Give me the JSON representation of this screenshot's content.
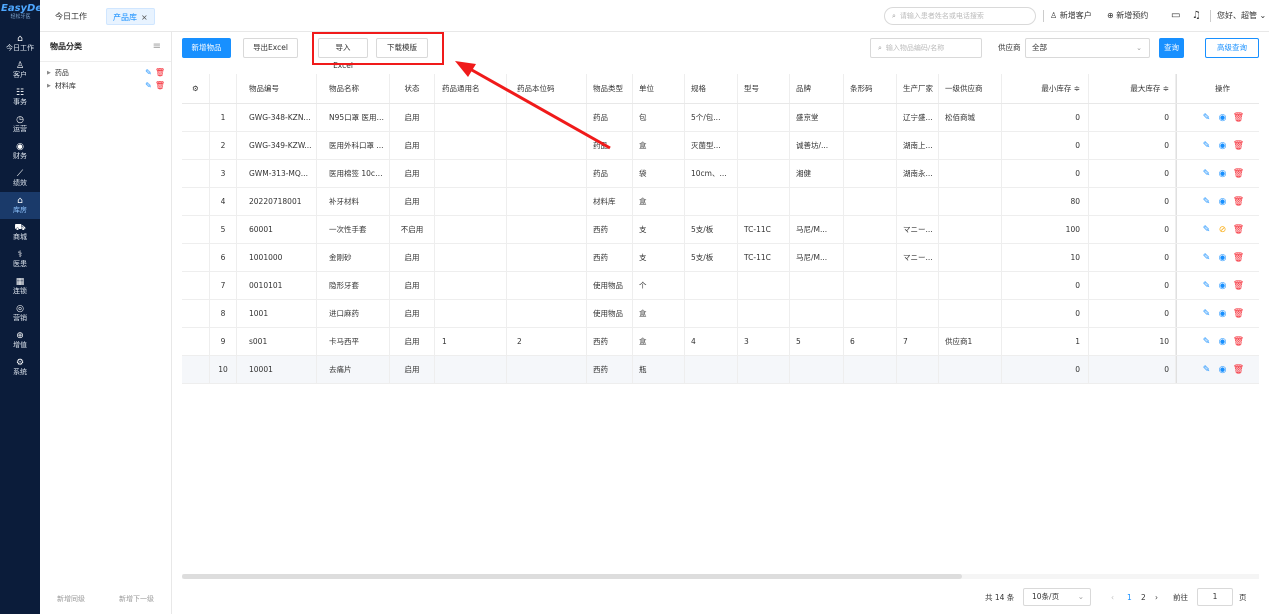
{
  "logo": {
    "line1": "EasyDent",
    "line2": "轻松牙医"
  },
  "nav": [
    {
      "icon": "⌂",
      "label": "今日工作"
    },
    {
      "icon": "♙",
      "label": "客户"
    },
    {
      "icon": "☷",
      "label": "事务"
    },
    {
      "icon": "◷",
      "label": "运营"
    },
    {
      "icon": "◉",
      "label": "财务"
    },
    {
      "icon": "⟋",
      "label": "绩效"
    },
    {
      "icon": "⌂",
      "label": "库房"
    },
    {
      "icon": "⛟",
      "label": "商城"
    },
    {
      "icon": "⚕",
      "label": "医患"
    },
    {
      "icon": "▦",
      "label": "连锁"
    },
    {
      "icon": "◎",
      "label": "营销"
    },
    {
      "icon": "⊕",
      "label": "增值"
    },
    {
      "icon": "⚙",
      "label": "系统"
    }
  ],
  "tabs": {
    "today": "今日工作",
    "product": "产品库",
    "close": "×"
  },
  "topbar": {
    "search_placeholder": "请输入患者姓名或电话搜索",
    "add_customer": "新增客户",
    "add_appointment": "新增预约",
    "greeting": "您好、超管"
  },
  "sidebar": {
    "title": "物品分类",
    "items": [
      {
        "label": "药品"
      },
      {
        "label": "材料库"
      }
    ],
    "add_same": "新增同级",
    "add_child": "新增下一级"
  },
  "toolbar": {
    "add": "新增物品",
    "export": "导出Excel",
    "import": "导入Excel",
    "download": "下载模版",
    "search_placeholder": "输入物品编码/名称",
    "supplier_label": "供应商",
    "supplier_value": "全部",
    "query": "查询",
    "advanced": "高级查询"
  },
  "table": {
    "headers": [
      "",
      "物品编号",
      "物品名称",
      "状态",
      "药品通用名",
      "药品本位码",
      "物品类型",
      "单位",
      "规格",
      "型号",
      "品牌",
      "条形码",
      "生产厂家",
      "一级供应商",
      "最小库存 ≑",
      "最大库存 ≑",
      "操作"
    ],
    "rows": [
      [
        "1",
        "GWG-348-KZN...",
        "N95口罩 医用防...",
        "启用",
        "",
        "",
        "药品",
        "包",
        "5个/包...",
        "",
        "盛京堂",
        "",
        "辽宁盛...",
        "松佰商城",
        "0",
        "0"
      ],
      [
        "2",
        "GWG-349-KZW...",
        "医用外科口罩 ...",
        "启用",
        "",
        "",
        "药品",
        "盒",
        "灭菌型...",
        "",
        "诚善坊/...",
        "",
        "湖南上...",
        "",
        "0",
        "0"
      ],
      [
        "3",
        "GWM-313-MQ...",
        "医用棉签 10cm...",
        "启用",
        "",
        "",
        "药品",
        "袋",
        "10cm、...",
        "",
        "湘健",
        "",
        "湖南永...",
        "",
        "0",
        "0"
      ],
      [
        "4",
        "20220718001",
        "补牙材料",
        "启用",
        "",
        "",
        "材料库",
        "盒",
        "",
        "",
        "",
        "",
        "",
        "",
        "80",
        "0"
      ],
      [
        "5",
        "60001",
        "一次性手套",
        "不启用",
        "",
        "",
        "西药",
        "支",
        "5支/板",
        "TC-11C",
        "马尼/M...",
        "",
        "マニー...",
        "",
        "100",
        "0"
      ],
      [
        "6",
        "1001000",
        "金刚砂",
        "启用",
        "",
        "",
        "西药",
        "支",
        "5支/板",
        "TC-11C",
        "马尼/M...",
        "",
        "マニー...",
        "",
        "10",
        "0"
      ],
      [
        "7",
        "0010101",
        "隐形牙套",
        "启用",
        "",
        "",
        "使用物品",
        "个",
        "",
        "",
        "",
        "",
        "",
        "",
        "0",
        "0"
      ],
      [
        "8",
        "1001",
        "进口麻药",
        "启用",
        "",
        "",
        "使用物品",
        "盒",
        "",
        "",
        "",
        "",
        "",
        "",
        "0",
        "0"
      ],
      [
        "9",
        "s001",
        "卡马西平",
        "启用",
        "1",
        "2",
        "西药",
        "盒",
        "4",
        "3",
        "5",
        "6",
        "7",
        "供应商1",
        "1",
        "10"
      ],
      [
        "10",
        "10001",
        "去痛片",
        "启用",
        "",
        "",
        "西药",
        "瓶",
        "",
        "",
        "",
        "",
        "",
        "",
        "0",
        "0"
      ]
    ]
  },
  "pager": {
    "total": "共 14 条",
    "page_size": "10条/页",
    "prev": "‹",
    "page1": "1",
    "page2": "2",
    "next": "›",
    "goto": "前往",
    "goto_value": "1",
    "page_suffix": "页"
  }
}
